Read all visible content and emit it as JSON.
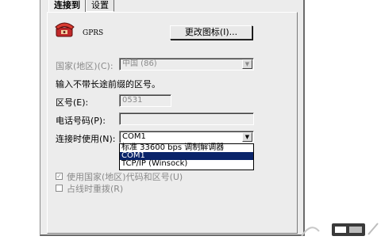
{
  "tabs": [
    "连接到",
    "设置"
  ],
  "connection": {
    "name": "GPRS",
    "change_icon_button": "更改图标(I)...",
    "country_label": "国家(地区)(C):",
    "country_value": "中国 (86)",
    "hint": "输入不带长途前缀的区号。",
    "area_code_label": "区号(E):",
    "area_code_value": "0531",
    "phone_label": "电话号码(P):",
    "phone_value": "",
    "connect_using_label": "连接时使用(N):",
    "connect_using_value": "COM1",
    "connect_using_options": [
      "标准 33600 bps 调制解调器",
      "COM1",
      "TCP/IP (Winsock)"
    ],
    "use_country_code_label": "使用国家(地区)代码和区号(U)",
    "redial_label": "占线时重拨(R)"
  },
  "colors": {
    "dialog_bg": "#ececec",
    "selection": "#0a246a"
  },
  "icons": {
    "connection_icon": "phone-icon",
    "watermark": "logo-icon"
  }
}
